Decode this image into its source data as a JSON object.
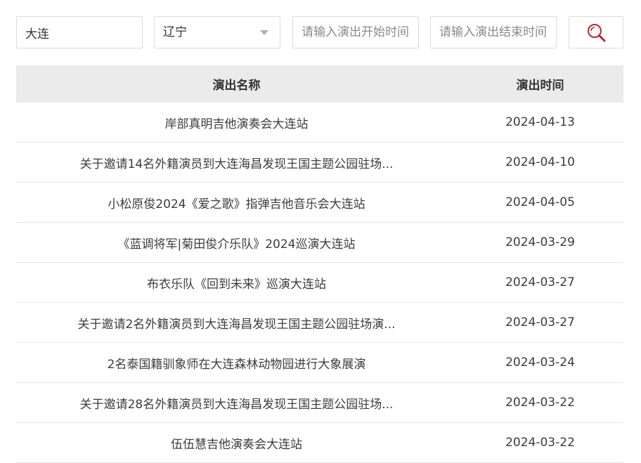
{
  "search": {
    "city_value": "大连",
    "province_selected": "辽宁",
    "start_placeholder": "请输入演出开始时间",
    "end_placeholder": "请输入演出结束时间",
    "search_icon": "magnifier-icon"
  },
  "table": {
    "headers": {
      "name": "演出名称",
      "date": "演出时间"
    },
    "rows": [
      {
        "name": "岸部真明吉他演奏会大连站",
        "date": "2024-04-13"
      },
      {
        "name": "关于邀请14名外籍演员到大连海昌发现王国主题公园驻场...",
        "date": "2024-04-10"
      },
      {
        "name": "小松原俊2024《爱之歌》指弹吉他音乐会大连站",
        "date": "2024-04-05"
      },
      {
        "name": "《蓝调将军|菊田俊介乐队》2024巡演大连站",
        "date": "2024-03-29"
      },
      {
        "name": "布衣乐队《回到未来》巡演大连站",
        "date": "2024-03-27"
      },
      {
        "name": "关于邀请2名外籍演员到大连海昌发现王国主题公园驻场演...",
        "date": "2024-03-27"
      },
      {
        "name": "2名泰国籍驯象师在大连森林动物园进行大象展演",
        "date": "2024-03-24"
      },
      {
        "name": "关于邀请28名外籍演员到大连海昌发现王国主题公园驻场...",
        "date": "2024-03-22"
      },
      {
        "name": "伍伍慧吉他演奏会大连站",
        "date": "2024-03-22"
      }
    ]
  },
  "colors": {
    "header_bg": "#ebebeb",
    "border": "#dcdcdc",
    "icon_red": "#b8262d"
  }
}
